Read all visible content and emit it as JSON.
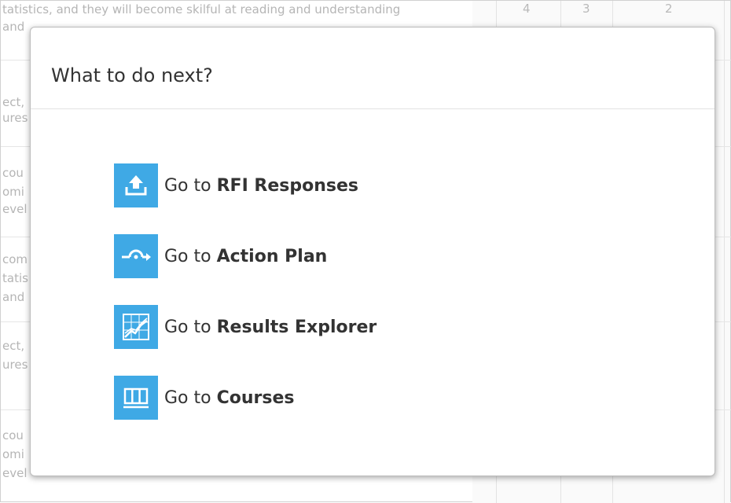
{
  "background": {
    "row1": "tatistics, and they will become skilful at reading and understanding",
    "row1b": "and",
    "row2a": "ect,",
    "row2b": "ures",
    "row3a": "cou",
    "row3b": "omi",
    "row3c": "evel",
    "row4a": "com",
    "row4b": "tatis",
    "row4c": "and",
    "row5a": "ect,",
    "row5b": "ures",
    "row6a": "cou",
    "row6b": "omi",
    "row6c": "evel",
    "num1": "4",
    "num2": "3",
    "num3": "2"
  },
  "modal": {
    "title": "What to do next?",
    "items": [
      {
        "prefix": "Go to ",
        "label": "RFI Responses",
        "icon": "upload-icon"
      },
      {
        "prefix": "Go to ",
        "label": "Action Plan",
        "icon": "action-plan-icon"
      },
      {
        "prefix": "Go to ",
        "label": "Results Explorer",
        "icon": "chart-icon"
      },
      {
        "prefix": "Go to ",
        "label": "Courses",
        "icon": "courses-icon"
      }
    ]
  },
  "colors": {
    "accent": "#3fa9e5"
  }
}
